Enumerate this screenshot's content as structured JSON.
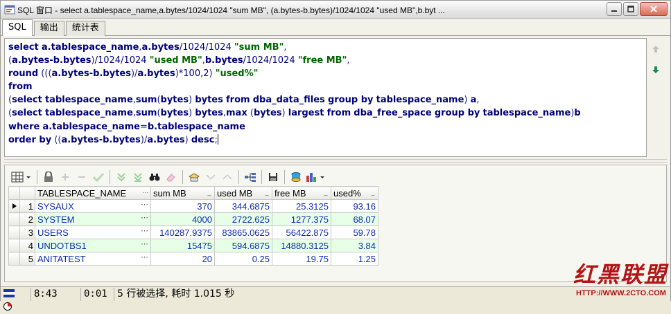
{
  "window": {
    "title": "SQL 窗口 - select a.tablespace_name,a.bytes/1024/1024 \"sum MB\", (a.bytes-b.bytes)/1024/1024 \"used MB\",b.byt ..."
  },
  "tabs": [
    {
      "label": "SQL"
    },
    {
      "label": "输出"
    },
    {
      "label": "统计表"
    }
  ],
  "editor": {
    "lines": [
      "select a.tablespace_name,a.bytes/1024/1024 \"sum MB\",",
      "(a.bytes-b.bytes)/1024/1024 \"used MB\",b.bytes/1024/1024 \"free MB\",",
      "round (((a.bytes-b.bytes)/a.bytes)*100,2) \"used%\"",
      "from",
      "(select tablespace_name,sum(bytes) bytes from dba_data_files group by tablespace_name) a,",
      "(select tablespace_name,sum(bytes) bytes,max (bytes) largest from dba_free_space group by tablespace_name)b",
      "where a.tablespace_name=b.tablespace_name",
      "order by ((a.bytes-b.bytes)/a.bytes) desc;"
    ]
  },
  "grid": {
    "columns": [
      "TABLESPACE_NAME",
      "sum MB",
      "used MB",
      "free MB",
      "used%"
    ],
    "rows": [
      {
        "num": "1",
        "name": "SYSAUX",
        "sum": "370",
        "used": "344.6875",
        "free": "25.3125",
        "pct": "93.16"
      },
      {
        "num": "2",
        "name": "SYSTEM",
        "sum": "4000",
        "used": "2722.625",
        "free": "1277.375",
        "pct": "68.07"
      },
      {
        "num": "3",
        "name": "USERS",
        "sum": "140287.9375",
        "used": "83865.0625",
        "free": "56422.875",
        "pct": "59.78"
      },
      {
        "num": "4",
        "name": "UNDOTBS1",
        "sum": "15475",
        "used": "594.6875",
        "free": "14880.3125",
        "pct": "3.84"
      },
      {
        "num": "5",
        "name": "ANITATEST",
        "sum": "20",
        "used": "0.25",
        "free": "19.75",
        "pct": "1.25"
      }
    ]
  },
  "status": {
    "cursor_pos": "8:43",
    "elapsed": "0:01",
    "message": "5 行被选择, 耗时 1.015 秒"
  },
  "watermark": {
    "text": "红黑联盟",
    "url": "HTTP://WWW.2CTO.COM"
  },
  "colors": {
    "keyword": "#000080",
    "string": "#006400",
    "cell_text": "#0b2cb7",
    "alt_row": "#e6ffe6"
  }
}
